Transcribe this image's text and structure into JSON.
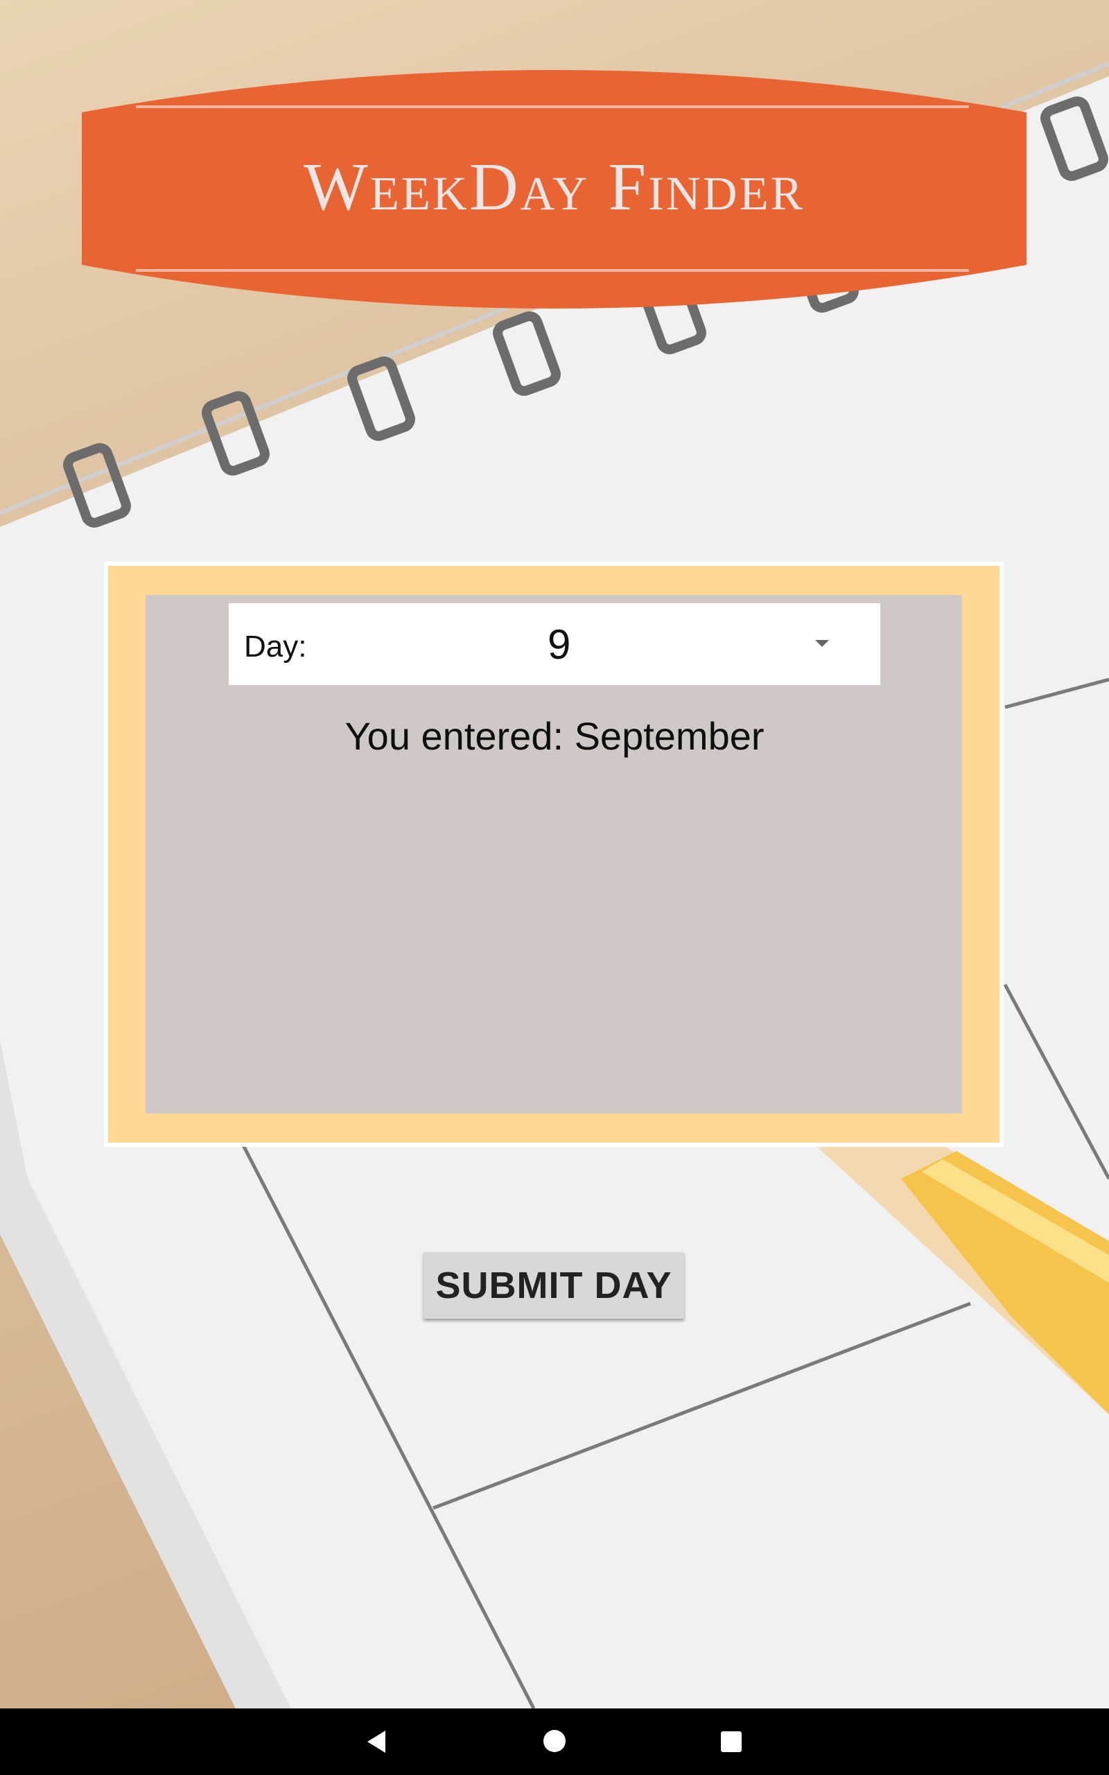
{
  "app": {
    "title": "WeekDay Finder"
  },
  "colors": {
    "banner": "#e96433",
    "card_frame": "#ffd894",
    "card_inner": "#d0c7c7",
    "button": "#d8d8d8",
    "navbar": "#000000"
  },
  "form": {
    "day_label": "Day:",
    "day_value": "9",
    "entered_text": "You entered: September"
  },
  "actions": {
    "submit_label": "SUBMIT DAY"
  },
  "navigation": {
    "back_icon": "back-triangle-icon",
    "home_icon": "home-circle-icon",
    "recents_icon": "recents-square-icon"
  }
}
